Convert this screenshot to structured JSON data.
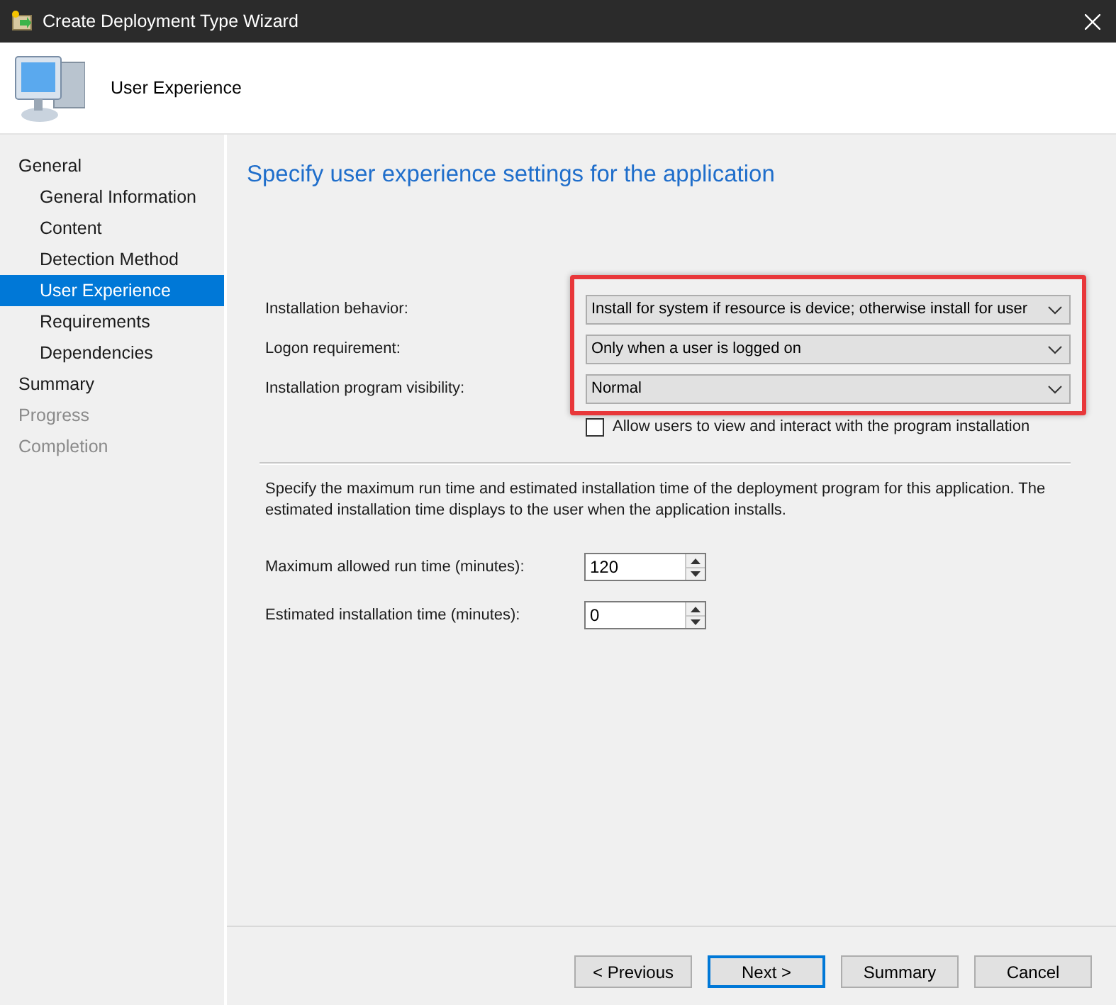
{
  "window": {
    "title": "Create Deployment Type Wizard"
  },
  "header": {
    "title": "User Experience"
  },
  "sidebar": {
    "items": [
      {
        "label": "General",
        "selected": false,
        "disabled": false,
        "children": [
          {
            "label": "General Information",
            "selected": false,
            "disabled": false
          },
          {
            "label": "Content",
            "selected": false,
            "disabled": false
          },
          {
            "label": "Detection Method",
            "selected": false,
            "disabled": false
          },
          {
            "label": "User Experience",
            "selected": true,
            "disabled": false
          },
          {
            "label": "Requirements",
            "selected": false,
            "disabled": false
          },
          {
            "label": "Dependencies",
            "selected": false,
            "disabled": false
          }
        ]
      },
      {
        "label": "Summary",
        "selected": false,
        "disabled": false
      },
      {
        "label": "Progress",
        "selected": false,
        "disabled": true
      },
      {
        "label": "Completion",
        "selected": false,
        "disabled": true
      }
    ]
  },
  "page": {
    "heading": "Specify user experience settings for the application",
    "settings": {
      "highlighted": true,
      "dropdowns": [
        {
          "label": "Installation behavior:",
          "value": "Install for system if resource is device; otherwise install for user"
        },
        {
          "label": "Logon requirement:",
          "value": "Only when a user is logged on"
        },
        {
          "label": "Installation program visibility:",
          "value": "Normal"
        }
      ]
    },
    "allow_interaction": {
      "label": "Allow users to view and interact with the program installation",
      "checked": false
    },
    "description": "Specify the maximum run time and estimated installation time of the deployment program for this application. The estimated installation time displays to the user when the application installs.",
    "spinners": [
      {
        "label": "Maximum allowed run time (minutes):",
        "value": "120"
      },
      {
        "label": "Estimated installation time (minutes):",
        "value": "0"
      }
    ]
  },
  "buttons": [
    {
      "label": "< Previous",
      "default": false
    },
    {
      "label": "Next >",
      "default": true
    },
    {
      "label": "Summary",
      "default": false
    },
    {
      "label": "Cancel",
      "default": false
    }
  ]
}
